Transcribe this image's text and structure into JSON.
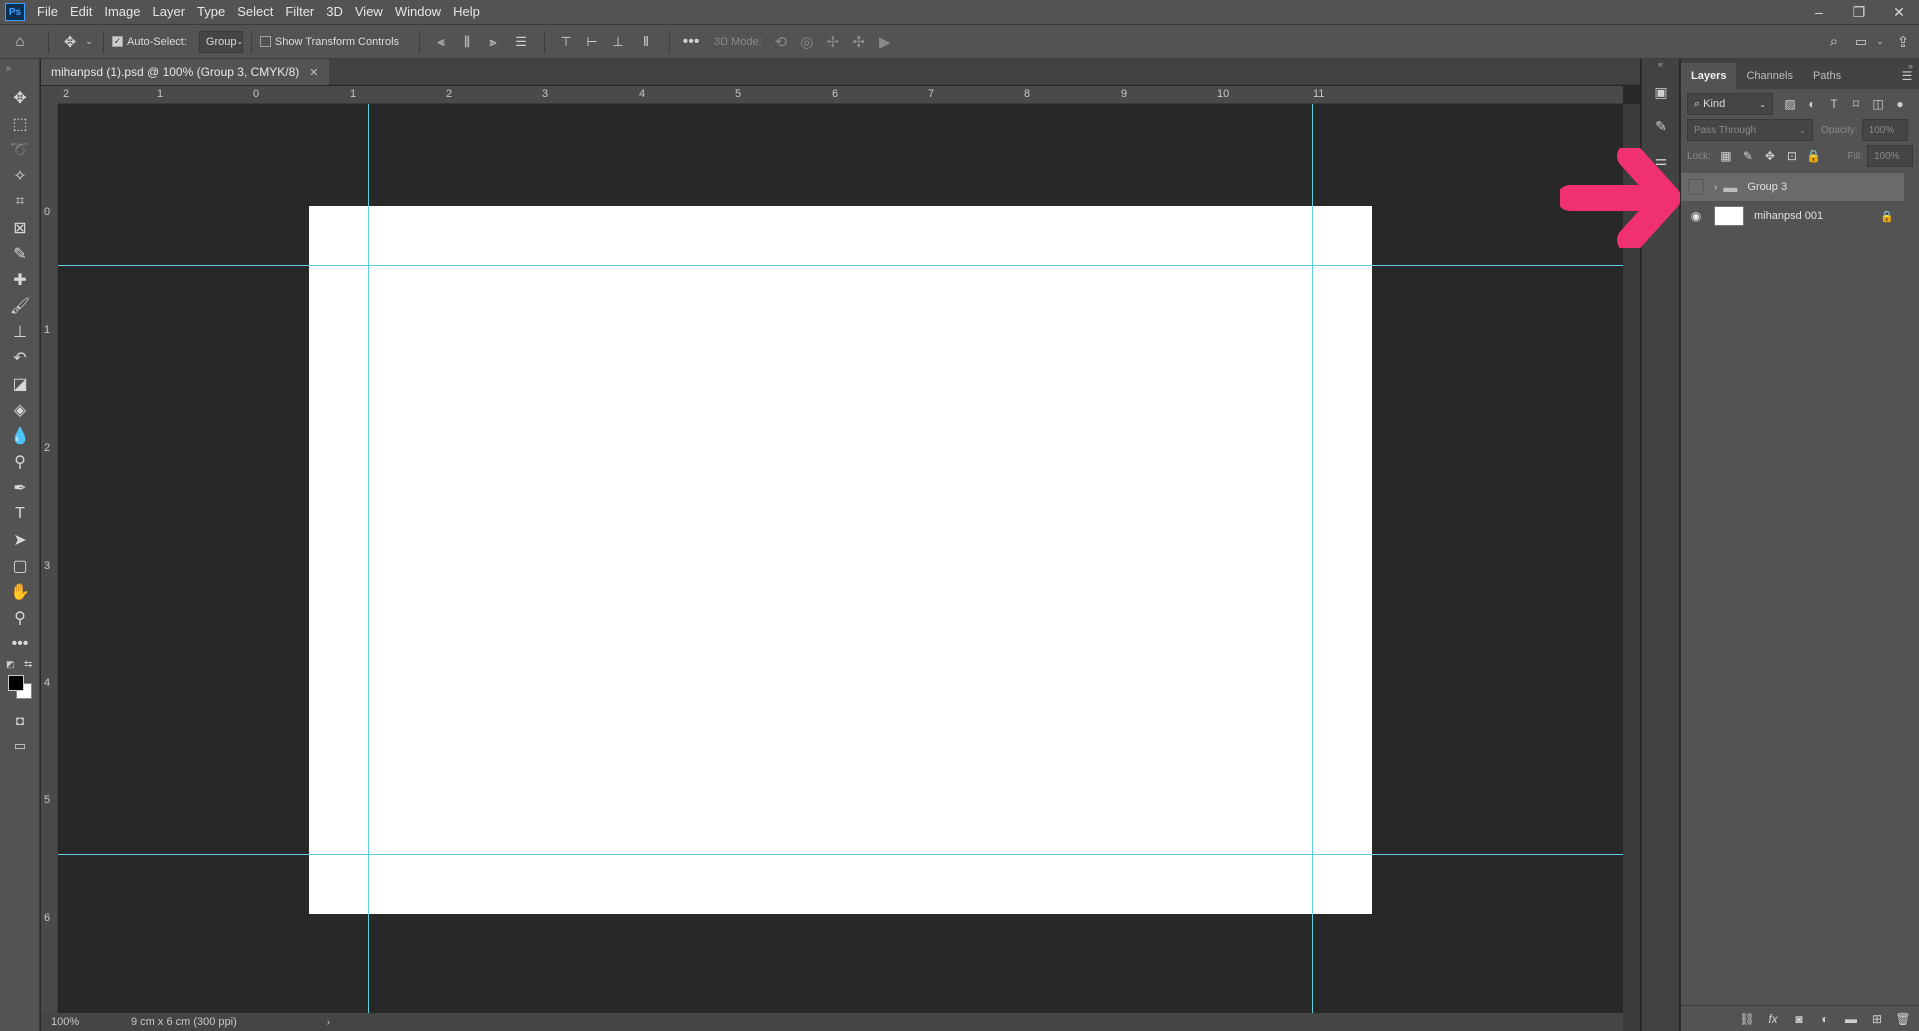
{
  "app": {
    "logo": "Ps"
  },
  "menu": [
    "File",
    "Edit",
    "Image",
    "Layer",
    "Type",
    "Select",
    "Filter",
    "3D",
    "View",
    "Window",
    "Help"
  ],
  "window_controls": [
    "minimize-icon",
    "restore-icon",
    "close-icon"
  ],
  "options": {
    "auto_select_label": "Auto-Select:",
    "auto_select_checked": true,
    "auto_select_target": "Group",
    "show_transform_label": "Show Transform Controls",
    "show_transform_checked": false,
    "mode_3d_label": "3D Mode:"
  },
  "document": {
    "tab_title": "mihanpsd (1).psd @ 100% (Group 3, CMYK/8)",
    "zoom": "100%",
    "doc_info": "9 cm x 6 cm (300 ppi)"
  },
  "rulers": {
    "horizontal": [
      "2",
      "1",
      "0",
      "1",
      "2",
      "3",
      "4",
      "5",
      "6",
      "7",
      "8",
      "9",
      "10",
      "11"
    ],
    "vertical": [
      "0",
      "1",
      "2",
      "3",
      "4",
      "5",
      "6"
    ]
  },
  "panel": {
    "tabs": [
      "Layers",
      "Channels",
      "Paths"
    ],
    "active_tab": "Layers",
    "filter_kind": "Kind",
    "blend_mode": "Pass Through",
    "opacity_label": "Opacity:",
    "opacity_value": "100%",
    "lock_label": "Lock:",
    "fill_label": "Fill:",
    "fill_value": "100%",
    "layers": [
      {
        "name": "Group 3",
        "type": "group",
        "visible": false,
        "selected": true
      },
      {
        "name": "mihanpsd 001",
        "type": "pixel",
        "visible": true,
        "locked": true
      }
    ]
  },
  "colors": {
    "guide": "#5fd2e6",
    "annotation_arrow": "#f0306f",
    "accent": "#39a1ff"
  }
}
